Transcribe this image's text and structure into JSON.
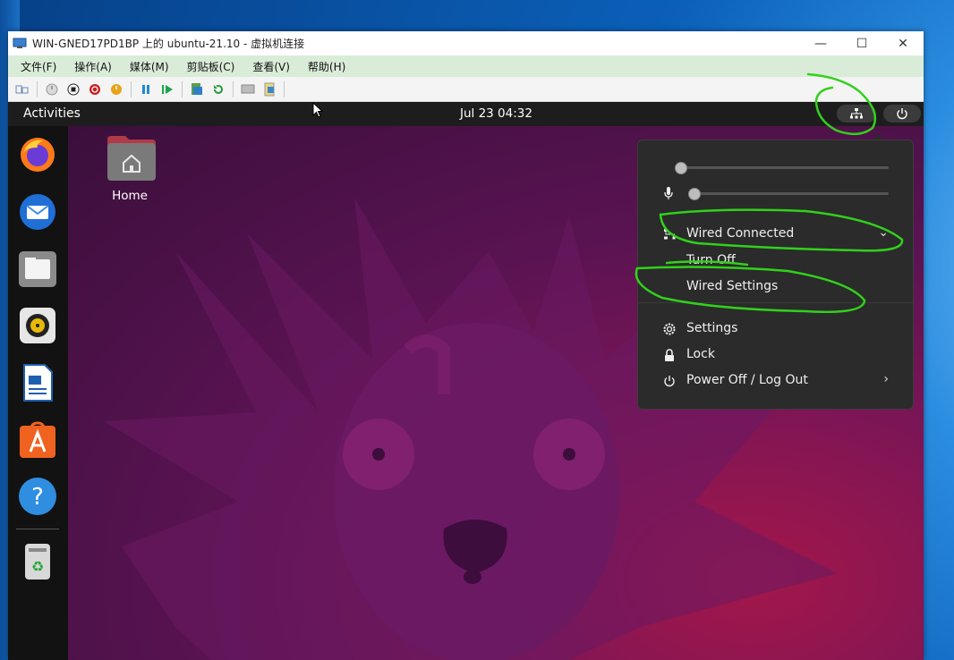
{
  "window": {
    "title": "WIN-GNED17PD1BP 上的 ubuntu-21.10 - 虚拟机连接",
    "min": "—",
    "max": "☐",
    "close": "✕"
  },
  "menu": [
    "文件(F)",
    "操作(A)",
    "媒体(M)",
    "剪贴板(C)",
    "查看(V)",
    "帮助(H)"
  ],
  "ubuntu": {
    "activities": "Activities",
    "clock": "Jul 23  04:32",
    "desktop_home_label": "Home"
  },
  "popup": {
    "wired_connected": "Wired Connected",
    "turn_off": "Turn Off",
    "wired_settings": "Wired Settings",
    "settings": "Settings",
    "lock": "Lock",
    "power_off": "Power Off / Log Out",
    "volume_level": 0.0,
    "mic_level": 0.0
  },
  "dock": {
    "apps": [
      "firefox",
      "thunderbird",
      "files",
      "rhythmbox",
      "libreoffice-writer",
      "ubuntu-software",
      "help",
      "trash"
    ]
  },
  "colors": {
    "annotation": "#31d11b",
    "ubuntu_topbar": "#1d1d1d",
    "menubar": "#d9ecd8"
  }
}
